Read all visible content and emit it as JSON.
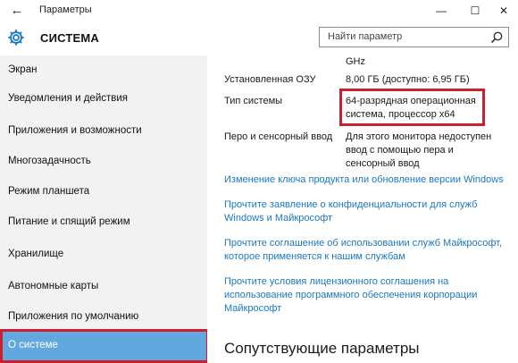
{
  "window": {
    "title": "Параметры",
    "back_glyph": "←",
    "minimize_glyph": "—",
    "maximize_glyph": "☐",
    "close_glyph": "✕"
  },
  "header": {
    "title": "СИСТЕМА",
    "icon": "gear-icon",
    "search_placeholder": "Найти параметр",
    "search_icon": "search-icon"
  },
  "sidebar": {
    "items": [
      {
        "label": "Экран"
      },
      {
        "label": "Уведомления и действия"
      },
      {
        "label": "Приложения и возможности"
      },
      {
        "label": "Многозадачность"
      },
      {
        "label": "Режим планшета"
      },
      {
        "label": "Питание и спящий режим"
      },
      {
        "label": "Хранилище"
      },
      {
        "label": "Автономные карты"
      },
      {
        "label": "Приложения по умолчанию"
      },
      {
        "label": "О системе",
        "selected": true
      }
    ],
    "selected_color": "#62a8e0",
    "highlight_color": "#cc1f2b"
  },
  "main": {
    "cpu_tail": "GHz",
    "rows": [
      {
        "label": "Установленная ОЗУ",
        "value": "8,00 ГБ (доступно: 6,95 ГБ)"
      },
      {
        "label": "Тип системы",
        "value_line1": "64-разрядная операционная",
        "value_line2": "система, процессор x64"
      },
      {
        "label": "Перо и сенсорный ввод",
        "value_line1": "Для этого монитора недоступен",
        "value_line2": "ввод с помощью пера и",
        "value_line3": "сенсорный ввод"
      }
    ],
    "links": [
      {
        "line1": "Изменение ключа продукта или обновление версии Windows"
      },
      {
        "line1": "Прочтите заявление о конфиденциальности для служб",
        "line2": "Windows и Майкрософт"
      },
      {
        "line1": "Прочтите соглашение об использовании служб Майкрософт,",
        "line2": "которое применяется к нашим службам"
      },
      {
        "line1": "Прочтите условия лицензионного соглашения на",
        "line2": "использование программного обеспечения корпорации",
        "line3": "Майкрософт"
      }
    ],
    "section_title": "Сопутствующие параметры",
    "link_color": "#1a78c2"
  }
}
